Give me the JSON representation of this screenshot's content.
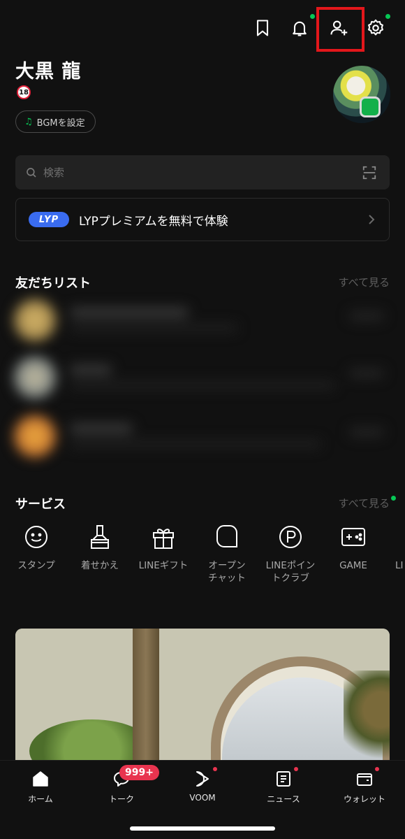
{
  "header": {
    "icons": [
      "bookmark-icon",
      "bell-icon",
      "add-friend-icon",
      "gear-icon"
    ]
  },
  "profile": {
    "name": "大黒 龍",
    "age_badge": "18",
    "bgm_label": "BGMを設定"
  },
  "search": {
    "placeholder": "検索"
  },
  "premium": {
    "logo": "LYP",
    "text": "LYPプレミアムを無料で体験"
  },
  "friends": {
    "title": "友だちリスト",
    "see_all": "すべて見る"
  },
  "services": {
    "title": "サービス",
    "see_all": "すべて見る",
    "items": [
      {
        "label": "スタンプ",
        "icon": "smile-icon"
      },
      {
        "label": "着せかえ",
        "icon": "brush-icon"
      },
      {
        "label": "LINEギフト",
        "icon": "gift-icon"
      },
      {
        "label": "オープン\nチャット",
        "icon": "open-chat-icon"
      },
      {
        "label": "LINEポイン\nトクラブ",
        "icon": "points-icon"
      },
      {
        "label": "GAME",
        "icon": "game-icon"
      },
      {
        "label": "LI",
        "icon": "partial-icon"
      }
    ]
  },
  "nav": {
    "items": [
      {
        "label": "ホーム",
        "icon": "home-icon"
      },
      {
        "label": "トーク",
        "icon": "chat-icon",
        "badge": "999+"
      },
      {
        "label": "VOOM",
        "icon": "voom-icon"
      },
      {
        "label": "ニュース",
        "icon": "news-icon"
      },
      {
        "label": "ウォレット",
        "icon": "wallet-icon"
      }
    ]
  },
  "colors": {
    "background": "#111111",
    "accent_green": "#06c755",
    "badge_red": "#e8344f",
    "highlight_red": "#e3171b",
    "lyp_blue": "#3a6cf0"
  }
}
